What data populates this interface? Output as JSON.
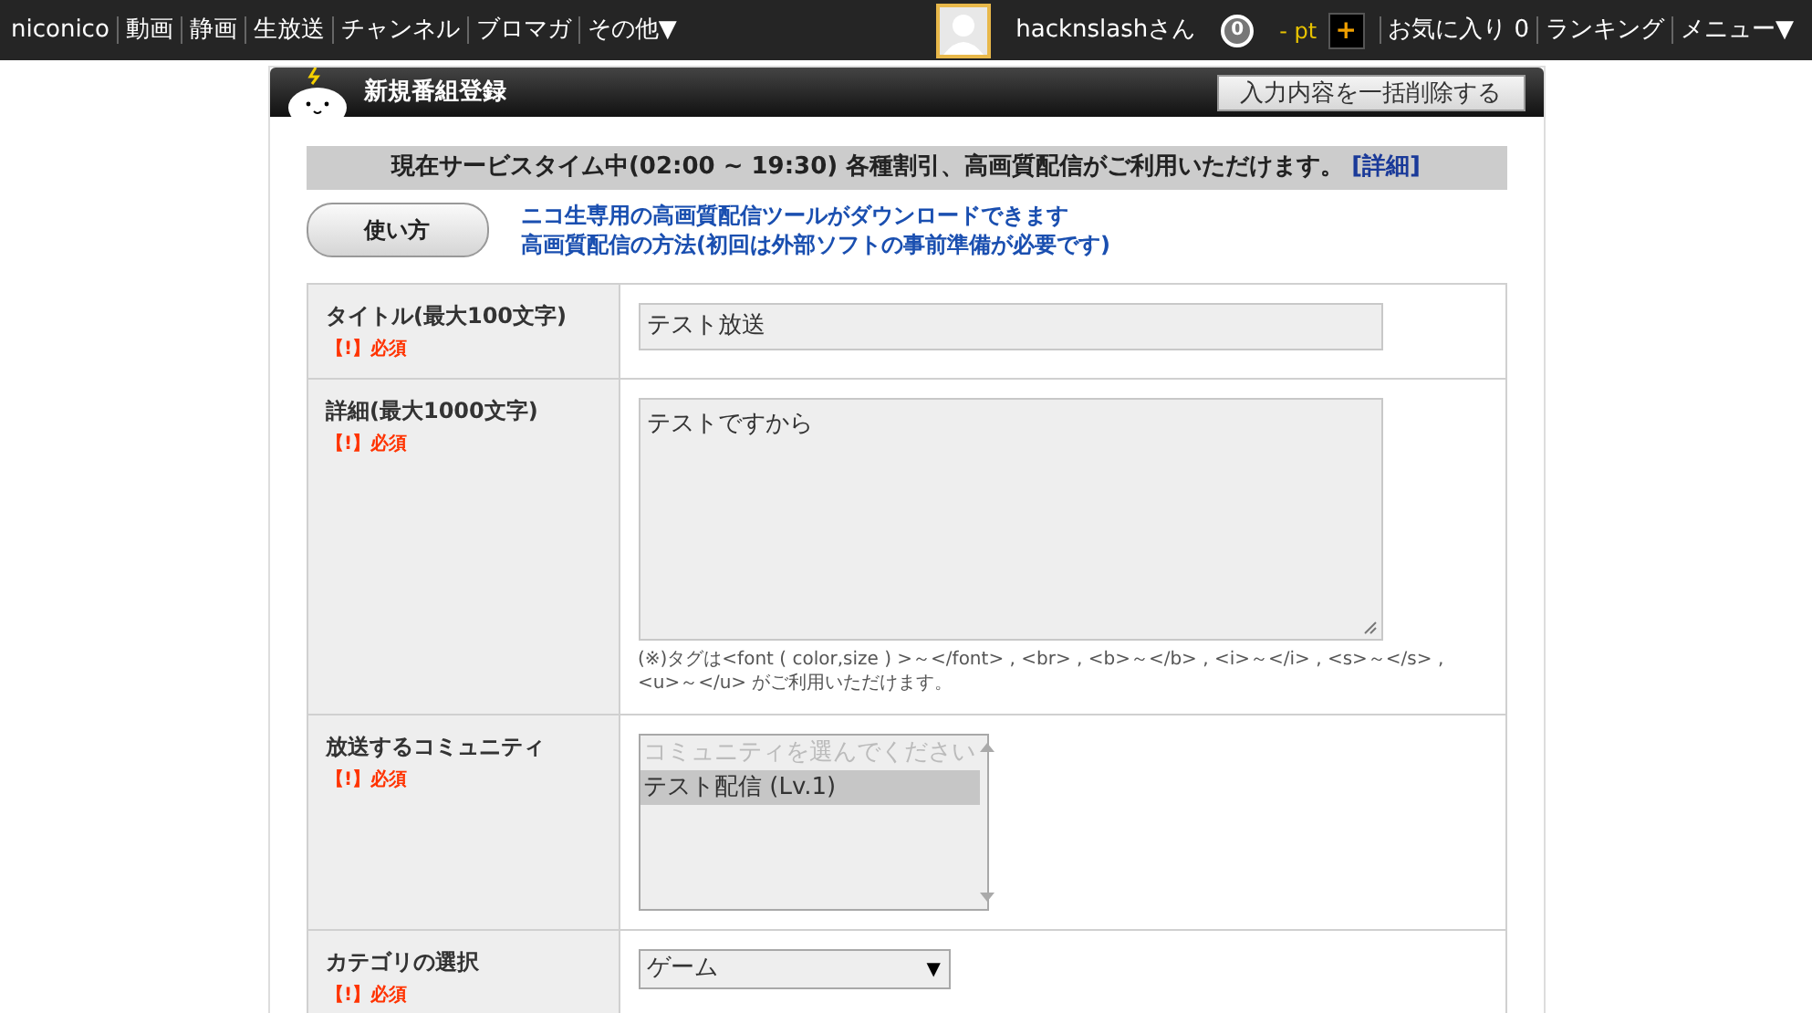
{
  "top_nav": {
    "brand": "niconico",
    "links": [
      "動画",
      "静画",
      "生放送",
      "チャンネル",
      "ブロマガ",
      "その他▼"
    ]
  },
  "user": {
    "name": "hacknslashさん",
    "badge_count": "0",
    "points": "- pt",
    "add_points": "+",
    "links": [
      "お気に入り 0",
      "ランキング",
      "メニュー▼"
    ]
  },
  "panel": {
    "title": "新規番組登録",
    "clear_button": "入力内容を一括削除する"
  },
  "notice": {
    "text": "現在サービスタイム中(02:00 ~ 19:30) 各種割引、高画質配信がご利用いただけます。",
    "link": "[詳細]"
  },
  "help_button": "使い方",
  "help_links": [
    "ニコ生専用の高画質配信ツールがダウンロードできます",
    "高画質配信の方法(初回は外部ソフトの事前準備が必要です)"
  ],
  "form_rows": [
    {
      "kind": "input",
      "label": "タイトル(最大100文字)",
      "required": "【!】必須",
      "value": "テスト放送"
    },
    {
      "kind": "textarea",
      "label": "詳細(最大1000文字)",
      "required": "【!】必須",
      "value": "テストですから",
      "note": "(※)タグは<font ( color,size ) >～</font> , <br> , <b>～</b> , <i>～</i> , <s>～</s> , <u>～</u> がご利用いただけます。"
    },
    {
      "kind": "listbox",
      "label": "放送するコミュニティ",
      "required": "【!】必須",
      "options": [
        {
          "text": "コミュニティを選んでください",
          "disabled": true,
          "selected": false
        },
        {
          "text": "テスト配信 (Lv.1)",
          "disabled": false,
          "selected": true
        }
      ]
    },
    {
      "kind": "select",
      "label": "カテゴリの選択",
      "required": "【!】必須",
      "value": "ゲーム",
      "arrow": "▼"
    }
  ]
}
